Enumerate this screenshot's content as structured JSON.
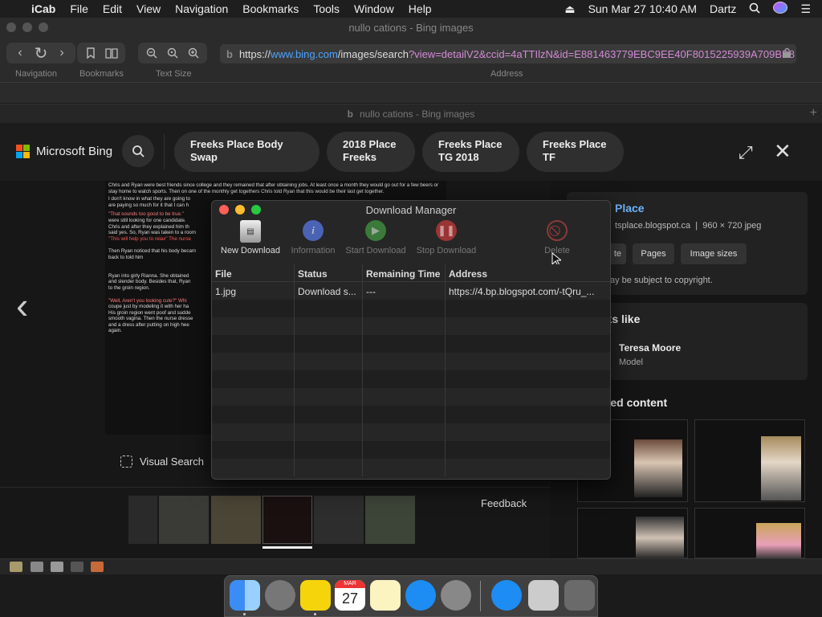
{
  "menubar": {
    "app": "iCab",
    "items": [
      "File",
      "Edit",
      "View",
      "Navigation",
      "Bookmarks",
      "Tools",
      "Window",
      "Help"
    ],
    "datetime": "Sun Mar 27  10:40 AM",
    "user": "Dartz"
  },
  "window": {
    "title": "nullo cations - Bing images",
    "tab_title": "nullo cations - Bing images"
  },
  "toolbar": {
    "navigation_label": "Navigation",
    "bookmarks_label": "Bookmarks",
    "textsize_label": "Text Size",
    "address_label": "Address",
    "url_scheme": "https://",
    "url_host": "www.bing.com",
    "url_path": "/images/search",
    "url_query": "?view=detailV2&ccid=4aTTIlzN&id=E881463779EBC9EE40F8015225939A709BB8"
  },
  "bing": {
    "brand": "Microsoft Bing",
    "pills": [
      "Freeks Place Body Swap",
      "2018 Place Freeks",
      "Freeks Place TG 2018",
      "Freeks Place TF"
    ],
    "visual_search": "Visual Search",
    "feedback": "Feedback"
  },
  "detail": {
    "title_fragment": "Place",
    "source": "tsplace.blogspot.ca",
    "dims": "960 × 720 jpeg",
    "tabs": [
      "te",
      "Pages",
      "Image sizes"
    ],
    "copyright": "ay be subject to copyright.",
    "looks_like": "oks like",
    "person_name": "Teresa Moore",
    "person_role": "Model",
    "related": "lated content"
  },
  "download_manager": {
    "title": "Download Manager",
    "buttons": [
      "New Download",
      "Information",
      "Start Download",
      "Stop Download",
      "Delete"
    ],
    "columns": [
      "File",
      "Status",
      "Remaining Time",
      "Address"
    ],
    "rows": [
      {
        "file": "1.jpg",
        "status": "Download s...",
        "remaining": "---",
        "address": "https://4.bp.blogspot.com/-tQru_..."
      }
    ]
  },
  "article": {
    "paragraph1": "Chris and Ryan were best friends since college and they remained that after obtaining jobs. At least once a month they would go out for a few beers or stay home to watch sports. Then on one of the monthly get togethers Chris told Ryan that this would be their last get together.",
    "paragraph2": "I don't know in what they are going to",
    "paragraph3": "are paying so much for it that I can h",
    "paragraph4": "\"That sounds too good to be true.\"",
    "paragraph5": "were still looking for one candidate.",
    "paragraph6": "Chris and after they explained him th",
    "paragraph7": "said yes. So, Ryan was taken to a room",
    "paragraph8": "\"This will help you to relax\" The nurse",
    "paragraph9": "Then Ryan noticed that his body becam",
    "paragraph10": "back to told him",
    "paragraph11": "Ryan into girly Rianna. She obtained",
    "paragraph12": "and slender body. Besides that, Ryan",
    "paragraph13": "to the groin region.",
    "paragraph14": "\"Well, Aren't you looking cute?\" Whi",
    "paragraph15": "coupe just by modeling it with her ha",
    "paragraph16": "His groin region went poof and sudde",
    "paragraph17": "smooth vagina. Then the nurse dresse",
    "paragraph18": "and a dress after putting on high hee",
    "paragraph19": "again."
  },
  "dock": {
    "calendar_month": "MAR",
    "calendar_day": "27"
  }
}
